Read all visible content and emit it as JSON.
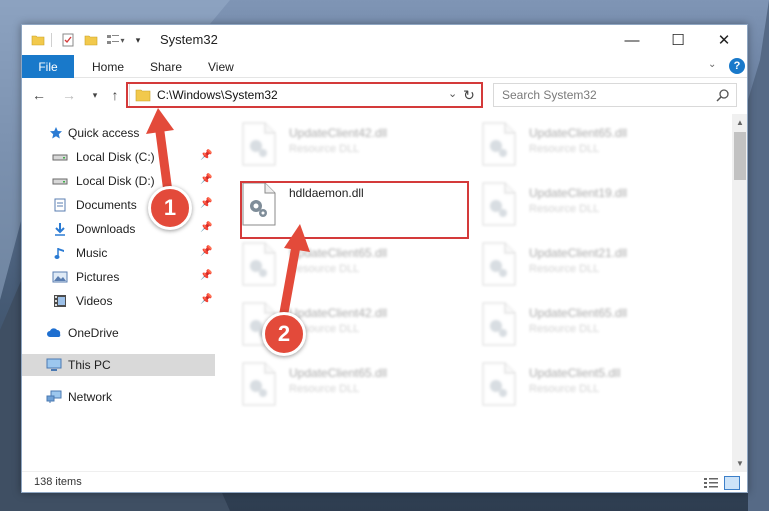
{
  "window": {
    "title": "System32",
    "controls": {
      "minimize": "—",
      "maximize": "☐",
      "close": "✕"
    },
    "quick_access_toolbar": {
      "dropdown_glyph": "▾",
      "view_glyph": "▾"
    }
  },
  "ribbon": {
    "tabs": [
      {
        "label": "File",
        "active": true
      },
      {
        "label": "Home"
      },
      {
        "label": "Share"
      },
      {
        "label": "View"
      }
    ],
    "expand_glyph": "⌄",
    "help_label": "?"
  },
  "navigation": {
    "back_glyph": "←",
    "forward_glyph": "→",
    "recent_glyph": "▾",
    "up_glyph": "↑",
    "address": "C:\\Windows\\System32",
    "address_dropdown_glyph": "⌄",
    "refresh_glyph": "↻",
    "search_placeholder": "Search System32"
  },
  "sidebar": {
    "pin_glyph": "📌",
    "items": [
      {
        "label": "Quick access",
        "icon": "star-icon"
      },
      {
        "label": "Local Disk (C:)",
        "icon": "drive-icon",
        "pinned": true
      },
      {
        "label": "Local Disk (D:)",
        "icon": "drive-icon",
        "pinned": true
      },
      {
        "label": "Documents",
        "icon": "documents-icon",
        "pinned": true
      },
      {
        "label": "Downloads",
        "icon": "download-icon",
        "pinned": true
      },
      {
        "label": "Music",
        "icon": "music-icon",
        "pinned": true
      },
      {
        "label": "Pictures",
        "icon": "pictures-icon",
        "pinned": true
      },
      {
        "label": "Videos",
        "icon": "videos-icon",
        "pinned": true
      },
      {
        "label": "OneDrive",
        "icon": "cloud-icon"
      },
      {
        "label": "This PC",
        "icon": "computer-icon",
        "selected": true
      },
      {
        "label": "Network",
        "icon": "network-icon"
      }
    ]
  },
  "files": [
    {
      "name": "UpdateClient42.dll",
      "type": "Resource DLL",
      "blurred": true
    },
    {
      "name": "UpdateClient65.dll",
      "type": "Resource DLL",
      "blurred": true
    },
    {
      "name": "hdldaemon.dll",
      "type": "",
      "blurred": false,
      "highlighted": true
    },
    {
      "name": "UpdateClient19.dll",
      "type": "Resource DLL",
      "blurred": true
    },
    {
      "name": "UpdateClient65.dll",
      "type": "Resource DLL",
      "blurred": true
    },
    {
      "name": "UpdateClient21.dll",
      "type": "Resource DLL",
      "blurred": true
    },
    {
      "name": "UpdateClient42.dll",
      "type": "Resource DLL",
      "blurred": true
    },
    {
      "name": "UpdateClient65.dll",
      "type": "Resource DLL",
      "blurred": true
    },
    {
      "name": "UpdateClient65.dll",
      "type": "Resource DLL",
      "blurred": true
    },
    {
      "name": "UpdateClient5.dll",
      "type": "Resource DLL",
      "blurred": true
    }
  ],
  "scrollbar": {
    "up_glyph": "▲",
    "down_glyph": "▼"
  },
  "status": {
    "item_count": "138 items"
  },
  "annotations": {
    "step1": "1",
    "step2": "2",
    "color": "#e34a3a",
    "highlight_color": "#d43a3a"
  }
}
